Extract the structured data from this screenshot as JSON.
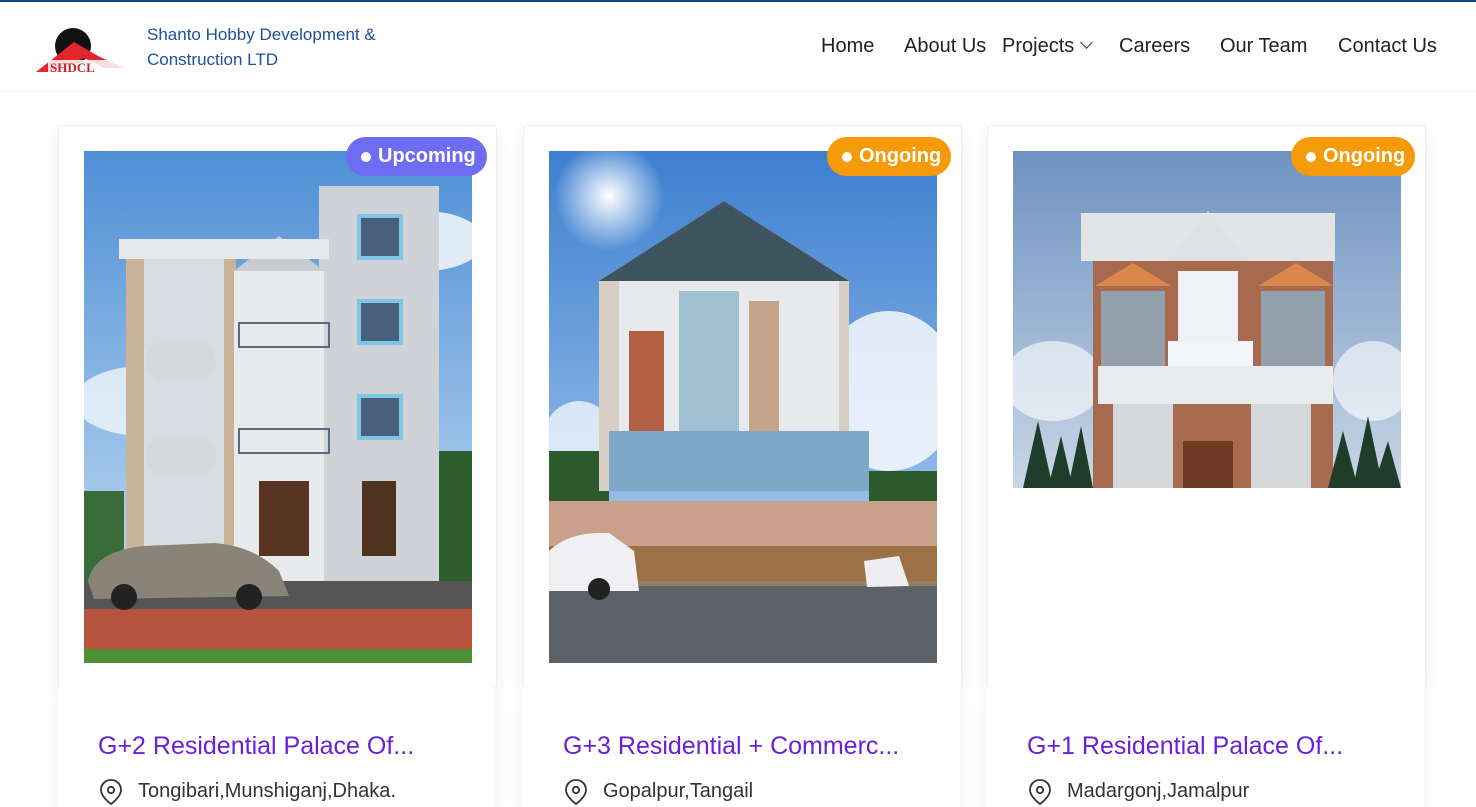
{
  "header": {
    "company_name_line1": "Shanto Hobby Development &",
    "company_name_line2": "Construction LTD",
    "logo_text": "SHDCL"
  },
  "nav": {
    "home": "Home",
    "about": "About Us",
    "projects": "Projects",
    "careers": "Careers",
    "team": "Our Team",
    "contact": "Contact Us"
  },
  "projects": [
    {
      "status": "Upcoming",
      "title": "G+2 Residential Palace Of...",
      "location": "Tongibari,Munshiganj,Dhaka."
    },
    {
      "status": "Ongoing",
      "title": "G+3 Residential + Commerc...",
      "location": "Gopalpur,Tangail"
    },
    {
      "status": "Ongoing",
      "title": "G+1 Residential Palace Of...",
      "location": "Madargonj,Jamalpur"
    }
  ],
  "colors": {
    "upcoming_badge": "#6e6cf2",
    "ongoing_badge": "#f59b0a",
    "title_purple": "#6a1fd8",
    "brand_blue": "#1f4fa0"
  },
  "icons": [
    "location-pin-icon",
    "chevron-down-icon"
  ]
}
